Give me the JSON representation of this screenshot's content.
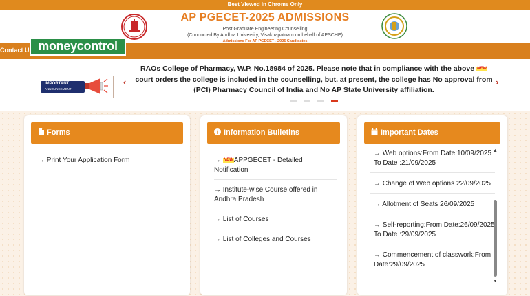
{
  "topbar": {
    "text": "Best Viewed in Chrome Only"
  },
  "header": {
    "title": "AP PGECET-2025 ADMISSIONS",
    "subtitle1": "Post Graduate Engineering Counselling",
    "subtitle2": "(Conducted By Andhra University, Visakhapatnam on behalf of APSCHE)",
    "subtitle3": "Admissions For AP PGECET - 2025 Candidates"
  },
  "nav": {
    "contact": "Contact Us"
  },
  "watermark": {
    "text": "moneycontrol"
  },
  "announcement": {
    "badge_line1": "IMPORTANT",
    "badge_line2": "ANNOUNCEMENT",
    "new_tag": "NEW",
    "text_part1": "RAOs College of Pharmacy, W.P. No.18984 of 2025. Please note that in compliance with the above",
    "text_part2": "court orders the college is included in the counselling, but, at present, the college has No approval from (PCI) Pharmacy Council of India and No AP State University affiliation.",
    "prev": "‹",
    "next": "›"
  },
  "forms": {
    "title": "Forms",
    "items": [
      "→ Print Your Application Form"
    ]
  },
  "bulletins": {
    "title": "Information Bulletins",
    "new_tag": "NEW",
    "items": [
      "APPGECET - Detailed Notification",
      "→ Institute-wise Course offered in Andhra Pradesh",
      "→ List of Courses",
      "→ List of Colleges and Courses"
    ],
    "first_prefix": "→ "
  },
  "dates": {
    "title": "Important Dates",
    "items": [
      "→ Web options:From Date:10/09/2025 To Date :21/09/2025",
      "→ Change of Web options 22/09/2025",
      "→ Allotment of Seats 26/09/2025",
      "→ Self-reporting:From Date:26/09/2025 To Date :29/09/2025",
      "→ Commencement of classwork:From Date:29/09/2025"
    ]
  },
  "colors": {
    "orange": "#e6891e",
    "navy": "#1f2f6e",
    "accent_red": "#d9391c",
    "mc_green": "#2b8f48"
  }
}
